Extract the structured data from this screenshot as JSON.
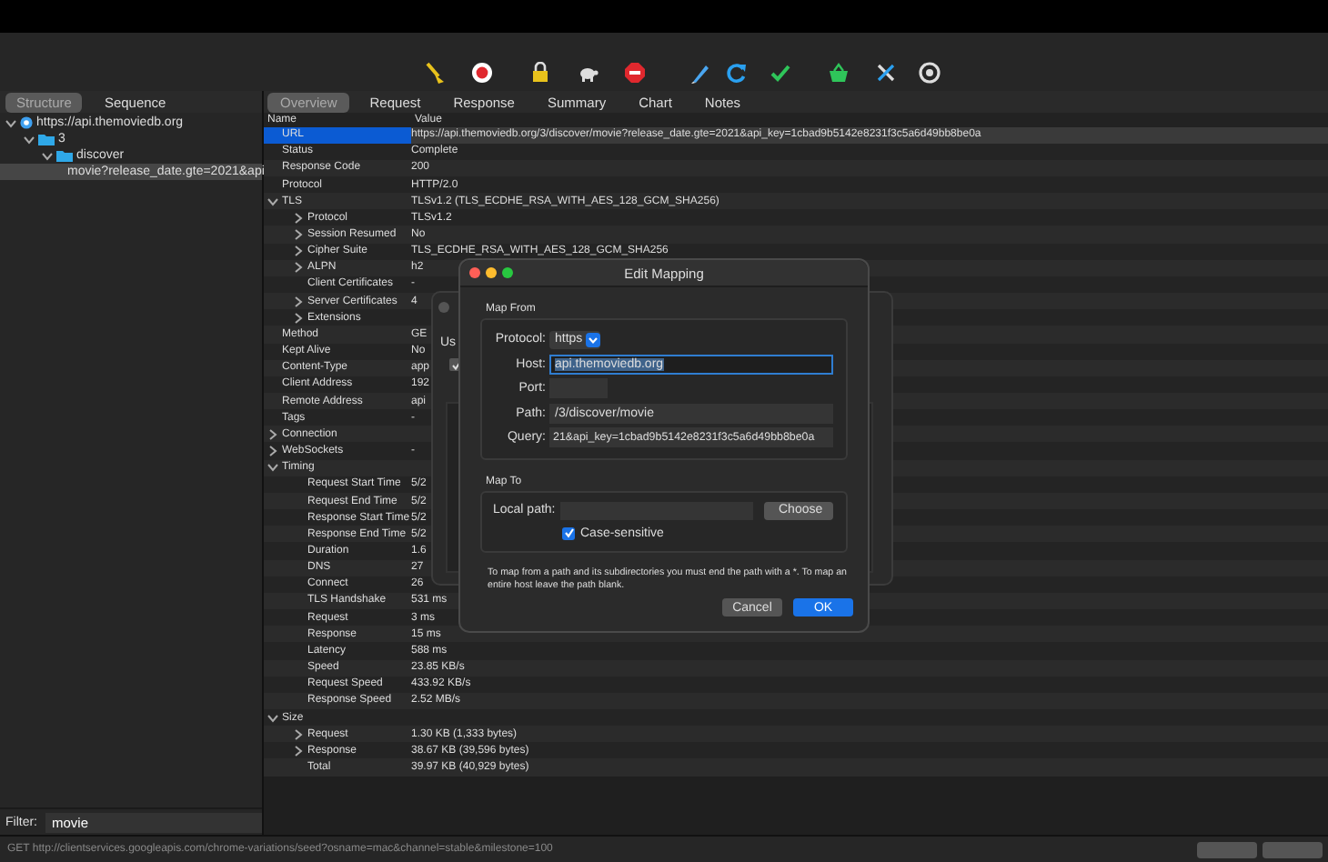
{
  "left_panel": {
    "tabs": [
      {
        "label": "Structure",
        "selected": true
      },
      {
        "label": "Sequence",
        "selected": false
      }
    ],
    "tree": [
      {
        "label": "https://api.themoviedb.org",
        "kind": "host",
        "expanded": true,
        "selected": false,
        "children": [
          {
            "label": "3",
            "kind": "folder",
            "expanded": true,
            "selected": false,
            "children": [
              {
                "label": "discover",
                "kind": "folder",
                "expanded": true,
                "selected": false,
                "children": [
                  {
                    "label": "movie?release_date.gte=2021&api",
                    "kind": "file",
                    "selected": true
                  }
                ]
              }
            ]
          }
        ]
      }
    ],
    "filter": {
      "label": "Filter:",
      "value": "movie"
    }
  },
  "detail": {
    "tabs": [
      {
        "label": "Overview",
        "selected": true
      },
      {
        "label": "Request",
        "selected": false
      },
      {
        "label": "Response",
        "selected": false
      },
      {
        "label": "Summary",
        "selected": false
      },
      {
        "label": "Chart",
        "selected": false
      },
      {
        "label": "Notes",
        "selected": false
      }
    ],
    "columns": [
      "Name",
      "Value"
    ],
    "rows": [
      {
        "name": "URL",
        "value": "https://api.themoviedb.org/3/discover/movie?release_date.gte=2021&api_key=1cbad9b5142e8231f3c5a6d49bb8be0a",
        "kind": "leaf",
        "selected": true
      },
      {
        "name": "Status",
        "value": "Complete",
        "kind": "leaf",
        "selected": false
      },
      {
        "name": "Response Code",
        "value": "200",
        "kind": "leaf",
        "selected": false
      },
      {
        "name": "Protocol",
        "value": "HTTP/2.0",
        "kind": "leaf",
        "selected": false
      },
      {
        "name": "TLS",
        "value": "TLSv1.2 (TLS_ECDHE_RSA_WITH_AES_128_GCM_SHA256)",
        "kind": "group",
        "expanded": true,
        "selected": false,
        "children": [
          {
            "name": "Protocol",
            "value": "TLSv1.2",
            "kind": "group",
            "expanded": false,
            "selected": false
          },
          {
            "name": "Session Resumed",
            "value": "No",
            "kind": "group",
            "expanded": false,
            "selected": false
          },
          {
            "name": "Cipher Suite",
            "value": "TLS_ECDHE_RSA_WITH_AES_128_GCM_SHA256",
            "kind": "group",
            "expanded": false,
            "selected": false
          },
          {
            "name": "ALPN",
            "value": "h2",
            "kind": "group",
            "expanded": false,
            "selected": false
          },
          {
            "name": "Client Certificates",
            "value": "-",
            "kind": "leaf",
            "selected": false
          },
          {
            "name": "Server Certificates",
            "value": "4",
            "kind": "group",
            "expanded": false,
            "selected": false
          },
          {
            "name": "Extensions",
            "kind": "group",
            "expanded": false,
            "selected": false
          }
        ]
      },
      {
        "name": "Method",
        "value": "GE",
        "kind": "leaf",
        "selected": false
      },
      {
        "name": "Kept Alive",
        "value": "No",
        "kind": "leaf",
        "selected": false
      },
      {
        "name": "Content-Type",
        "value": "app",
        "kind": "leaf",
        "selected": false
      },
      {
        "name": "Client Address",
        "value": "192",
        "kind": "leaf",
        "selected": false
      },
      {
        "name": "Remote Address",
        "value": "api",
        "kind": "leaf",
        "selected": false
      },
      {
        "name": "Tags",
        "value": "-",
        "kind": "leaf",
        "selected": false
      },
      {
        "name": "Connection",
        "kind": "group",
        "expanded": false,
        "selected": false
      },
      {
        "name": "WebSockets",
        "value": "-",
        "kind": "group",
        "expanded": false,
        "selected": false
      },
      {
        "name": "Timing",
        "kind": "group",
        "expanded": true,
        "selected": false,
        "children": [
          {
            "name": "Request Start Time",
            "value": "5/2",
            "kind": "leaf",
            "selected": false
          },
          {
            "name": "Request End Time",
            "value": "5/2",
            "kind": "leaf",
            "selected": false
          },
          {
            "name": "Response Start Time",
            "value": "5/2",
            "kind": "leaf",
            "selected": false
          },
          {
            "name": "Response End Time",
            "value": "5/2",
            "kind": "leaf",
            "selected": false
          },
          {
            "name": "Duration",
            "value": "1.6",
            "kind": "leaf",
            "selected": false
          },
          {
            "name": "DNS",
            "value": "27",
            "kind": "leaf",
            "selected": false
          },
          {
            "name": "Connect",
            "value": "26",
            "kind": "leaf",
            "selected": false
          },
          {
            "name": "TLS Handshake",
            "value": "531 ms",
            "kind": "leaf",
            "selected": false
          },
          {
            "name": "Request",
            "value": "3 ms",
            "kind": "leaf",
            "selected": false
          },
          {
            "name": "Response",
            "value": "15 ms",
            "kind": "leaf",
            "selected": false
          },
          {
            "name": "Latency",
            "value": "588 ms",
            "kind": "leaf",
            "selected": false
          },
          {
            "name": "Speed",
            "value": "23.85 KB/s",
            "kind": "leaf",
            "selected": false
          },
          {
            "name": "Request Speed",
            "value": "433.92 KB/s",
            "kind": "leaf",
            "selected": false
          },
          {
            "name": "Response Speed",
            "value": "2.52 MB/s",
            "kind": "leaf",
            "selected": false
          }
        ]
      },
      {
        "name": "Size",
        "kind": "group",
        "expanded": true,
        "selected": false,
        "children": [
          {
            "name": "Request",
            "value": "1.30 KB (1,333 bytes)",
            "kind": "group",
            "expanded": false,
            "selected": false
          },
          {
            "name": "Response",
            "value": "38.67 KB (39,596 bytes)",
            "kind": "group",
            "expanded": false,
            "selected": false
          },
          {
            "name": "Total",
            "value": "39.97 KB (40,929 bytes)",
            "kind": "leaf",
            "selected": false
          }
        ]
      }
    ]
  },
  "background_dialog": {
    "label": "Us",
    "checked": true
  },
  "dialog": {
    "title": "Edit Mapping",
    "map_from": {
      "title": "Map From",
      "fields": [
        {
          "label": "Protocol:",
          "value": "https",
          "kind": "select",
          "focused": false
        },
        {
          "label": "Host:",
          "value": "api.themoviedb.org",
          "kind": "text",
          "focused": true
        },
        {
          "label": "Port:",
          "kind": "short",
          "focused": false
        },
        {
          "label": "Path:",
          "value": "/3/discover/movie",
          "kind": "text",
          "focused": false
        },
        {
          "label": "Query:",
          "value": "21&api_key=1cbad9b5142e8231f3c5a6d49bb8be0a",
          "kind": "text",
          "focused": false
        }
      ]
    },
    "map_to": {
      "title": "Map To",
      "local_path_label": "Local path:",
      "choose_button": "Choose",
      "checkbox": {
        "label": "Case-sensitive",
        "checked": true
      }
    },
    "note": "To map from a path and its subdirectories you must end the path with a *. To map an entire host leave the path blank.",
    "buttons": [
      {
        "label": "Cancel",
        "default": false
      },
      {
        "label": "OK",
        "default": true
      }
    ]
  },
  "status_bar": {
    "text": "GET http://clientservices.googleapis.com/chrome-variations/seed?osname=mac&channel=stable&milestone=100"
  }
}
